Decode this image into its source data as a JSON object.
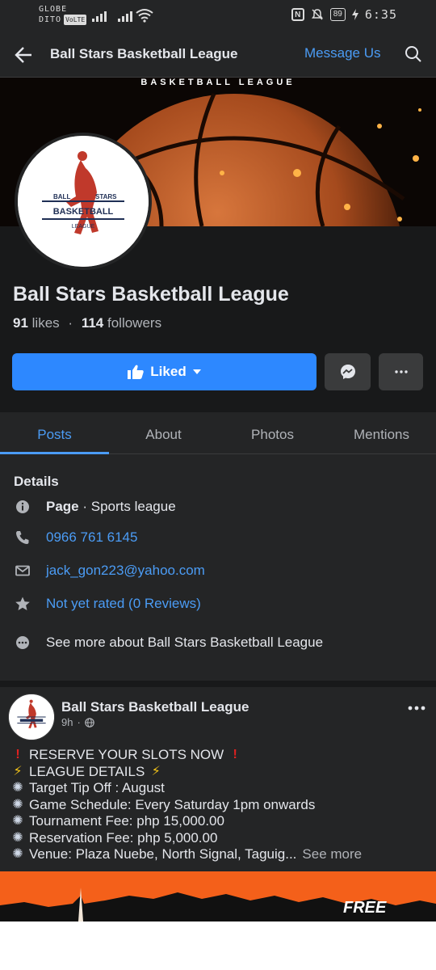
{
  "status_bar": {
    "carrier_line1": "GLOBE",
    "carrier_line2": "DITO",
    "volte": "VoLTE",
    "battery": "89",
    "time": "6:35"
  },
  "header": {
    "title": "Ball Stars Basketball League",
    "message_link": "Message Us",
    "icons": [
      "back-arrow-icon",
      "search-icon"
    ]
  },
  "cover": {
    "banner_text": "BASKETBALL LEAGUE"
  },
  "logo": {
    "ball": "BALL",
    "stars": "STARS",
    "basketball": "BASKETBALL",
    "league": "LEAGUE"
  },
  "page": {
    "name": "Ball Stars Basketball League",
    "likes_count": "91",
    "likes_label": "likes",
    "followers_count": "114",
    "followers_label": "followers"
  },
  "actions": {
    "liked_label": "Liked",
    "liked_color": "#2d88ff"
  },
  "tabs": [
    {
      "label": "Posts",
      "active": true
    },
    {
      "label": "About",
      "active": false
    },
    {
      "label": "Photos",
      "active": false
    },
    {
      "label": "Mentions",
      "active": false
    }
  ],
  "details": {
    "title": "Details",
    "page_type_label": "Page",
    "page_type_value": " · Sports league",
    "phone": "0966 761 6145",
    "email": "jack_gon223@yahoo.com",
    "rating": "Not yet rated (0 Reviews)",
    "see_more": "See more about Ball Stars Basketball League"
  },
  "post": {
    "author": "Ball Stars Basketball League",
    "time": "9h",
    "lines": [
      "RESERVE YOUR SLOTS NOW",
      "LEAGUE DETAILS",
      "Target Tip Off : August",
      "Game Schedule: Every Saturday 1pm onwards",
      "Tournament Fee: php 15,000.00",
      "Reservation Fee: php 5,000.00",
      "Venue: Plaza Nuebe, North Signal, Taguig..."
    ],
    "see_more": "See more",
    "image_text": "FREE"
  },
  "colors": {
    "background": "#18191a",
    "surface": "#242526",
    "accent_link": "#4b9cf5",
    "primary_button": "#2d88ff"
  }
}
